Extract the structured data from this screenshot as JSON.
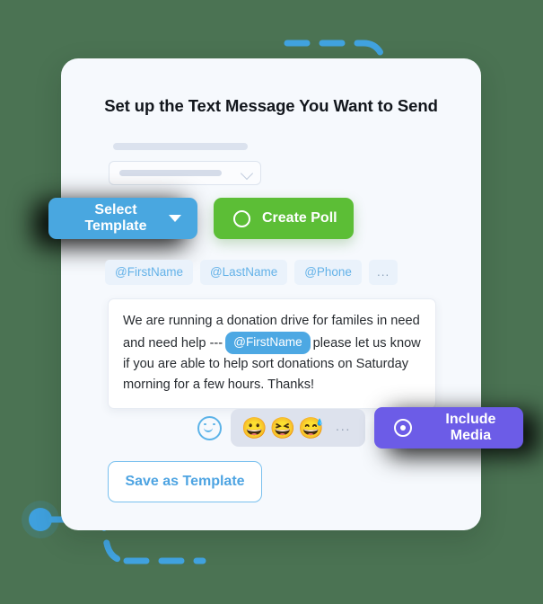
{
  "theme": {
    "background": "#4b7353",
    "card_background": "#f6f9fd",
    "accent_blue": "#49a7e0",
    "accent_green": "#5cbe36",
    "accent_purple": "#6c5ce7",
    "tag_text": "#64b2e8",
    "tag_background": "#eaf2fb"
  },
  "card": {
    "title": "Set up the Text Message You Want to Send"
  },
  "template_field": {
    "label_placeholder": "",
    "select_placeholder": "",
    "chevron_icon": "chevron-down-icon"
  },
  "actions": {
    "select_template": {
      "label": "Select Template",
      "caret_icon": "caret-down-icon"
    },
    "create_poll": {
      "label": "Create Poll",
      "icon": "circle-outline-icon"
    }
  },
  "merge_tags": [
    {
      "label": "@FirstName"
    },
    {
      "label": "@LastName"
    },
    {
      "label": "@Phone"
    },
    {
      "label": "..."
    }
  ],
  "message": {
    "part1": "We are running a donation drive for familes in need and need help ---",
    "inline_tag": "@FirstName",
    "part2": "please let us know if you are able to help sort donations on Saturday morning for a few hours. Thanks!"
  },
  "emoji_bar": {
    "picker_icon": "smiley-face-icon",
    "emojis": [
      "😀",
      "😆",
      "😅"
    ],
    "more_label": "..."
  },
  "include_media": {
    "label": "Include Media",
    "icon": "record-circle-icon"
  },
  "save_template": {
    "label": "Save as Template"
  },
  "decorations": {
    "top_path": "dashed-connector-path",
    "bottom_path": "dashed-connector-path",
    "top_dot": "blue-node-dot",
    "bottom_dot": "blue-node-dot"
  }
}
